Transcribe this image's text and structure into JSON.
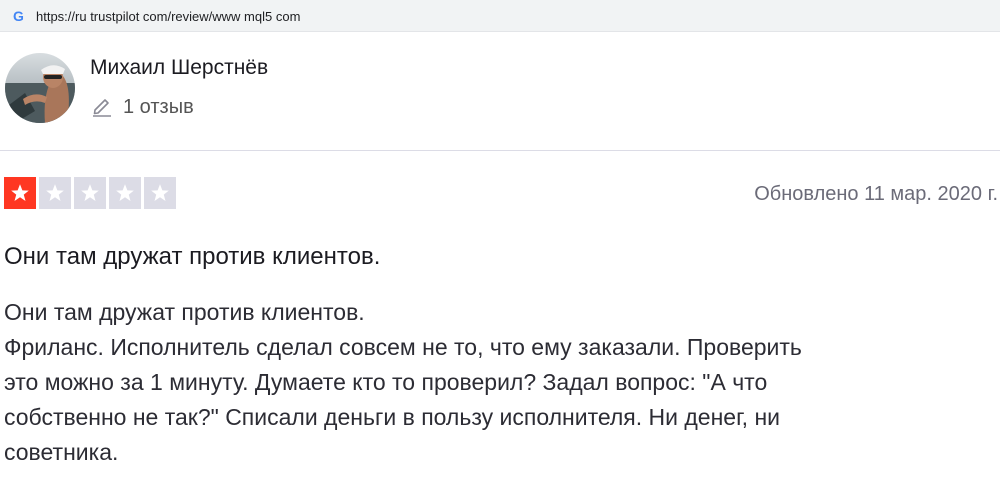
{
  "browser": {
    "url": "https://ru trustpilot com/review/www mql5 com",
    "favicon_letter": "G"
  },
  "reviewer": {
    "name": "Михаил Шерстнёв",
    "review_count": "1 отзыв"
  },
  "review": {
    "rating": 1,
    "rating_max": 5,
    "date": "Обновлено 11 мар. 2020 г.",
    "title": "Они там дружат против клиентов.",
    "body_lines": [
      "Они там дружат против клиентов.",
      "Фриланс. Исполнитель сделал совсем не то, что ему заказали. Проверить",
      "это можно за 1 минуту. Думаете кто то проверил? Задал вопрос: \"А что",
      "собственно не так?\" Списали деньги в пользу исполнителя. Ни денег, ни",
      "советника."
    ]
  },
  "colors": {
    "star_filled": "#ff3722",
    "star_empty": "#dcdce6"
  },
  "icons": {
    "favicon": "google-icon",
    "pen": "pen-icon",
    "star": "star-icon"
  }
}
